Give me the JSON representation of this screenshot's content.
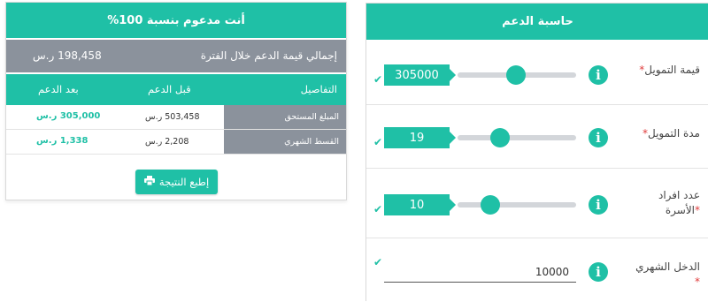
{
  "result": {
    "title": "أنت مدعوم بنسبة 100%",
    "total_label": "إجمالي قيمة الدعم خلال الفترة",
    "total_value": "198,458 ر.س",
    "columns": {
      "details": "التفاصيل",
      "before": "قبل الدعم",
      "after": "بعد الدعم"
    },
    "rows": [
      {
        "label": "المبلغ المستحق",
        "before": "503,458 ر.س",
        "after": "305,000 ر.س"
      },
      {
        "label": "القسط الشهري",
        "before": "2,208 ر.س",
        "after": "1,338 ر.س"
      }
    ],
    "print_label": "إطبع النتيجة",
    "print_icon": "printer-icon"
  },
  "calculator": {
    "title": "حاسبة الدعم",
    "fields": [
      {
        "label": "قيمة التمويل",
        "required": "*",
        "value": "305000",
        "slider_fraction": 0.49
      },
      {
        "label": "مدة التمويل",
        "required": "*",
        "value": "19",
        "slider_fraction": 0.33
      },
      {
        "label_line1": "عدد افراد",
        "label_line2": "الأسرة",
        "required": "*",
        "value": "10",
        "slider_fraction": 0.23
      },
      {
        "label": "الدخل الشهري",
        "required": "*",
        "value": "10000"
      }
    ],
    "info_icon": "info-icon",
    "check_icon": "check-icon"
  },
  "colors": {
    "accent": "#1fc0a6",
    "gray_band": "#8b929c",
    "required": "#e03c3c"
  }
}
